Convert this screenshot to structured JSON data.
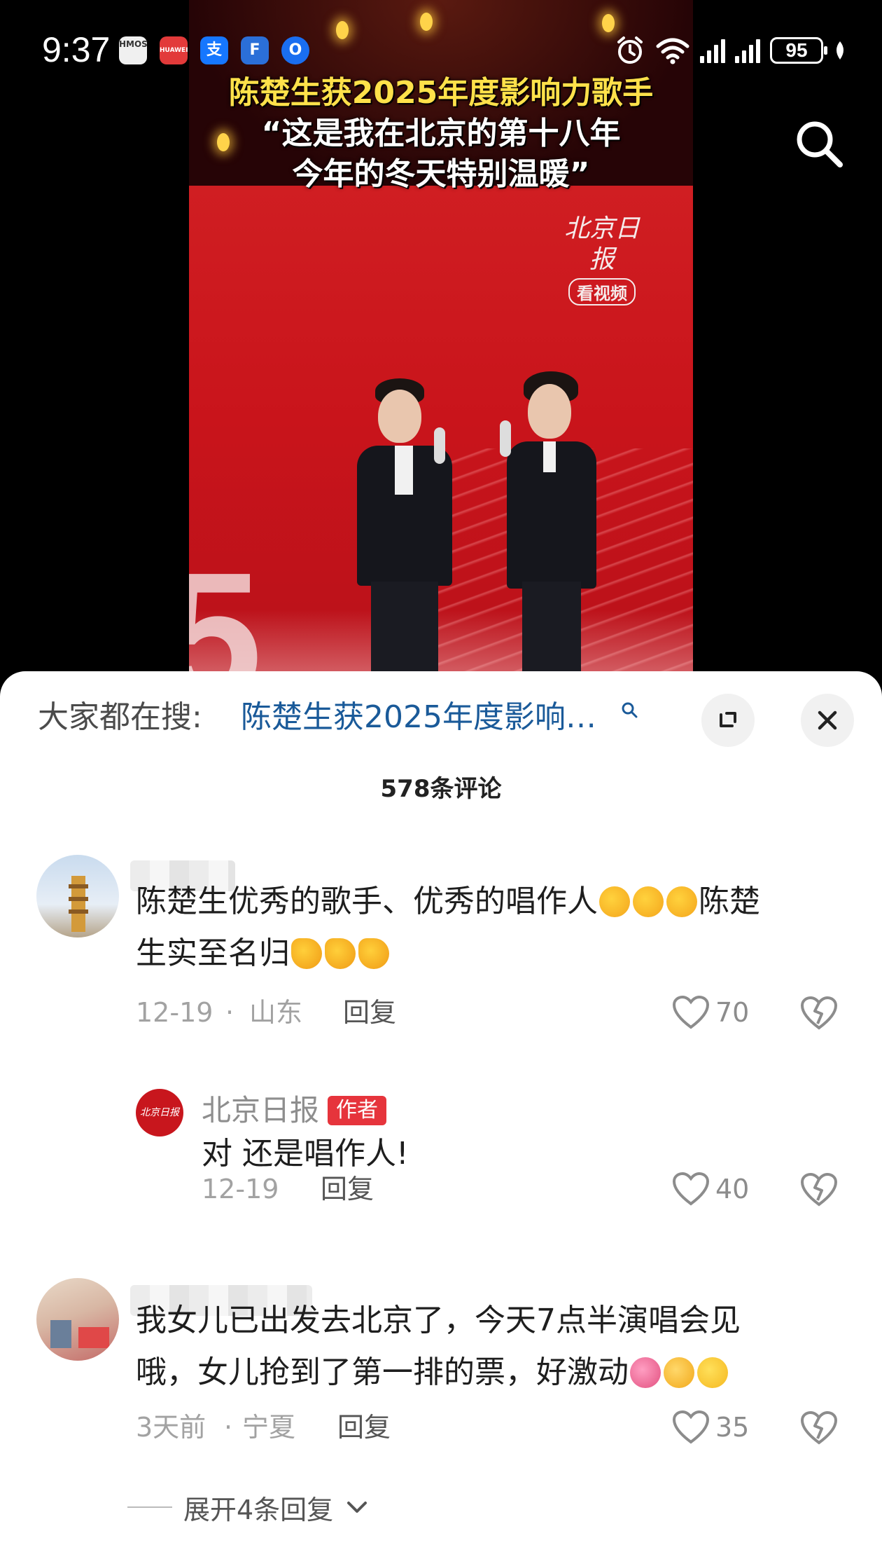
{
  "status_bar": {
    "time": "9:37",
    "battery": "95",
    "app_icons": [
      "HMOS",
      "HUAWEI",
      "支",
      "F",
      "O"
    ]
  },
  "video": {
    "caption_lines": [
      "陈楚生获2025年度影响力歌手",
      "“这是我在北京的第十八年",
      "今年的冬天特别温暖”"
    ],
    "watermark_title": "北京日报",
    "watermark_sub": "看视频"
  },
  "sheet": {
    "search_label": "大家都在搜:",
    "search_query": "陈楚生获2025年度影响…",
    "comment_count": "578条评论"
  },
  "comments": [
    {
      "text_a": "陈楚生优秀的歌手、优秀的唱作人",
      "text_b": "陈楚",
      "text_c": "生实至名归",
      "date": "12-19",
      "sep": "·",
      "location": "山东",
      "reply_label": "回复",
      "likes": "70"
    },
    {
      "author": "北京日报",
      "badge": "作者",
      "text": "对 还是唱作人!",
      "date": "12-19",
      "reply_label": "回复",
      "likes": "40",
      "avatar_text": "北京日报"
    },
    {
      "text_a": "我女儿已出发去北京了，今天7点半演唱会见",
      "text_b": "哦，女儿抢到了第一排的票，好激动",
      "date": "3天前",
      "sep": "·",
      "location": "宁夏",
      "reply_label": "回复",
      "likes": "35",
      "expand_label": "展开4条回复"
    }
  ],
  "colors": {
    "link": "#1a5a99",
    "badge": "#e6343c",
    "video_red": "#d01e22"
  },
  "icons": [
    "search-icon",
    "expand-icon",
    "close-icon",
    "heart-icon",
    "broken-heart-icon",
    "chevron-down-icon",
    "alarm-icon",
    "wifi-icon",
    "signal-icon"
  ]
}
